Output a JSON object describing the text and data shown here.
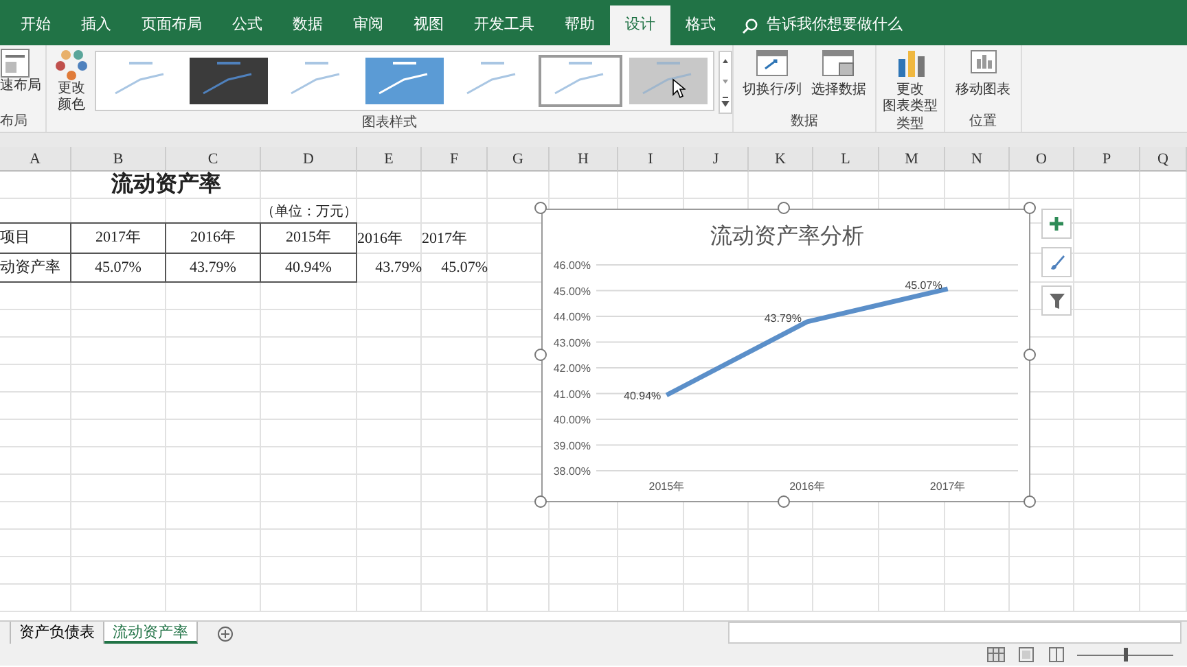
{
  "ribbon_tabs": [
    {
      "label": "开始",
      "selected": false
    },
    {
      "label": "插入",
      "selected": false
    },
    {
      "label": "页面布局",
      "selected": false
    },
    {
      "label": "公式",
      "selected": false
    },
    {
      "label": "数据",
      "selected": false
    },
    {
      "label": "审阅",
      "selected": false
    },
    {
      "label": "视图",
      "selected": false
    },
    {
      "label": "开发工具",
      "selected": false
    },
    {
      "label": "帮助",
      "selected": false
    },
    {
      "label": "设计",
      "selected": true
    },
    {
      "label": "格式",
      "selected": false
    }
  ],
  "tell_me": {
    "placeholder": "告诉我你想要做什么"
  },
  "ribbon": {
    "quick_layout": {
      "label": "速布局",
      "group": "布局"
    },
    "change_colors": {
      "label": "更改",
      "label_2": "颜色"
    },
    "chart_styles": {
      "group": "图表样式",
      "thumbnails": [
        {
          "kind": "light",
          "selected": false
        },
        {
          "kind": "dark",
          "selected": false
        },
        {
          "kind": "light",
          "selected": false
        },
        {
          "kind": "blue",
          "selected": false
        },
        {
          "kind": "light",
          "selected": false
        },
        {
          "kind": "light",
          "selected": true
        },
        {
          "kind": "grey",
          "selected": false
        }
      ]
    },
    "data_group": {
      "label": "数据",
      "buttons": [
        "切换行/列",
        "选择数据"
      ]
    },
    "type_group": {
      "label": "类型",
      "button": "更改",
      "button_2": "图表类型"
    },
    "location_group": {
      "label": "位置",
      "button": "移动图表"
    }
  },
  "columns": [
    "A",
    "B",
    "C",
    "D",
    "E",
    "F",
    "G",
    "H",
    "I",
    "J",
    "K",
    "L",
    "M",
    "N",
    "O",
    "P",
    "Q"
  ],
  "rows": [
    {
      "kind": "title",
      "cells": [
        null,
        "流动资产率"
      ]
    },
    {
      "kind": "note",
      "cells": [
        null,
        null,
        null,
        "（单位：万元）"
      ]
    },
    {
      "kind": "header",
      "cells": [
        "项目",
        "2017年",
        "2016年",
        "2015年",
        "2016年",
        "2017年"
      ]
    },
    {
      "kind": "data",
      "cells": [
        "动资产率",
        "45.07%",
        "43.79%",
        "40.94%",
        "43.79%",
        "45.07%"
      ]
    }
  ],
  "chart": {
    "chart_data": {
      "type": "line",
      "title": "流动资产率分析",
      "categories": [
        "2015年",
        "2016年",
        "2017年"
      ],
      "series": [
        {
          "color": "#5b8fc9",
          "values": [
            40.94,
            43.79,
            45.07
          ]
        }
      ],
      "ylim": [
        38,
        46
      ],
      "yticks": [
        {
          "value": 38,
          "label": "38.00%"
        },
        {
          "value": 39,
          "label": "39.00%"
        },
        {
          "value": 40,
          "label": "40.00%"
        },
        {
          "value": 41,
          "label": "41.00%"
        },
        {
          "value": 42,
          "label": "42.00%"
        },
        {
          "value": 43,
          "label": "43.00%"
        },
        {
          "value": 44,
          "label": "44.00%"
        },
        {
          "value": 45,
          "label": "45.00%"
        },
        {
          "value": 46,
          "label": "46.00%"
        }
      ],
      "value_labels": [
        "40.94%",
        "43.79%",
        "45.07%"
      ],
      "grid": true
    }
  },
  "sheet_tabs": [
    {
      "label": "资产负债表",
      "selected": false
    },
    {
      "label": "流动资产率",
      "selected": true
    }
  ],
  "zoom": {
    "level": 0.5
  }
}
